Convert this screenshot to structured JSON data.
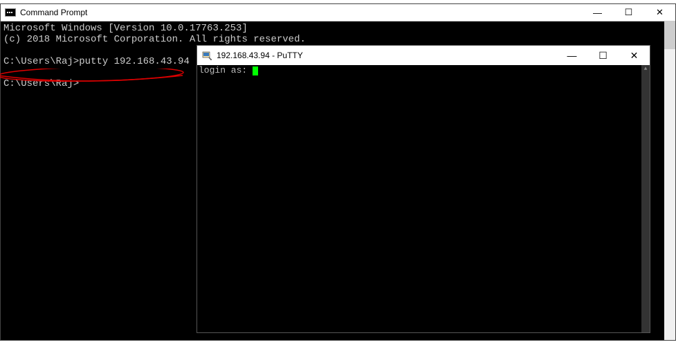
{
  "cmd": {
    "title": "Command Prompt",
    "line1": "Microsoft Windows [Version 10.0.17763.253]",
    "line2": "(c) 2018 Microsoft Corporation. All rights reserved.",
    "prompt1": "C:\\Users\\Raj>putty 192.168.43.94",
    "prompt2": "C:\\Users\\Raj>"
  },
  "putty": {
    "title": "192.168.43.94 - PuTTY",
    "prompt": "login as: "
  },
  "buttons": {
    "minimize": "—",
    "maximize": "☐",
    "close": "✕"
  }
}
